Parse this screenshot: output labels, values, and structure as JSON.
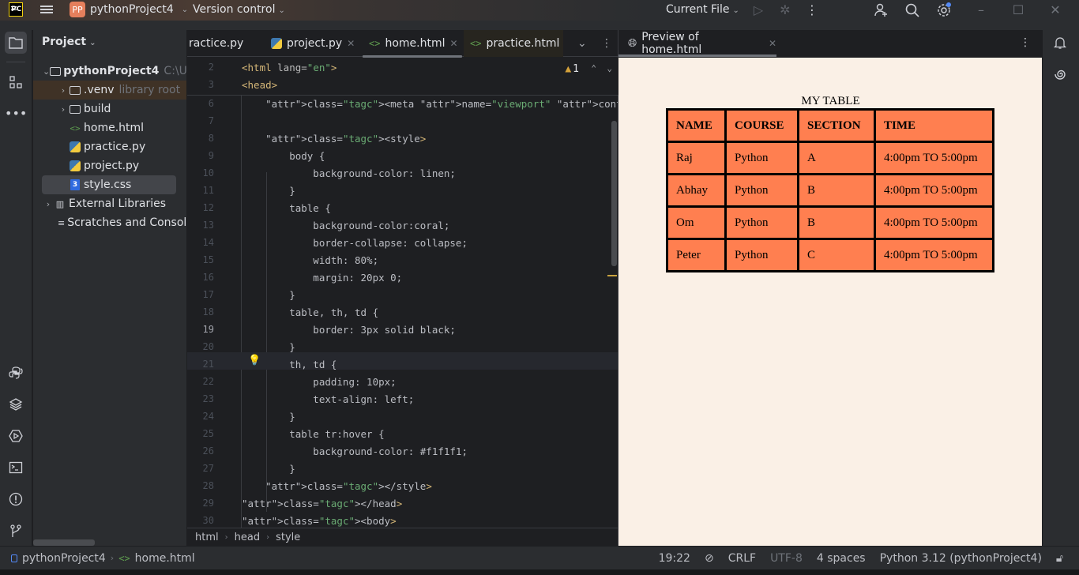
{
  "titlebar": {
    "logo": "PC",
    "project_badge": "PP",
    "project_name": "pythonProject4",
    "version_control": "Version control",
    "run_config": "Current File"
  },
  "toolwindow": {
    "title": "Project",
    "tree": [
      {
        "label": "pythonProject4",
        "suffix": "C:\\Use",
        "type": "folder",
        "expanded": true,
        "level": 0
      },
      {
        "label": ".venv",
        "suffix": "library root",
        "type": "folder",
        "expanded": false,
        "level": 1
      },
      {
        "label": "build",
        "suffix": "",
        "type": "folder",
        "expanded": false,
        "level": 1
      },
      {
        "label": "home.html",
        "suffix": "",
        "type": "html",
        "level": 1
      },
      {
        "label": "practice.py",
        "suffix": "",
        "type": "python",
        "level": 1
      },
      {
        "label": "project.py",
        "suffix": "",
        "type": "python",
        "level": 1
      },
      {
        "label": "style.css",
        "suffix": "",
        "type": "css",
        "level": 1,
        "selected": true
      },
      {
        "label": "External Libraries",
        "suffix": "",
        "type": "library",
        "level": 0
      },
      {
        "label": "Scratches and Consoles",
        "suffix": "",
        "type": "scratch",
        "level": 0
      }
    ]
  },
  "editor": {
    "tabs": [
      {
        "label": "ractice.py",
        "type": "python"
      },
      {
        "label": "project.py",
        "type": "python"
      },
      {
        "label": "home.html",
        "type": "html",
        "active": true
      },
      {
        "label": "practice.html",
        "type": "html"
      }
    ],
    "warnings_count": "1",
    "sticky_lines": [
      {
        "n": "2",
        "text": "<html lang=\"en\">"
      },
      {
        "n": "3",
        "text": "<head>"
      }
    ],
    "lines": [
      {
        "n": "6",
        "text": "    <meta name=\"viewport\" content=\"width=device-width, initi"
      },
      {
        "n": "7",
        "text": ""
      },
      {
        "n": "8",
        "text": "    <style>"
      },
      {
        "n": "9",
        "text": "        body {"
      },
      {
        "n": "10",
        "text": "            background-color: linen;"
      },
      {
        "n": "11",
        "text": "        }"
      },
      {
        "n": "12",
        "text": "        table {"
      },
      {
        "n": "13",
        "text": "            background-color:coral;"
      },
      {
        "n": "14",
        "text": "            border-collapse: collapse;"
      },
      {
        "n": "15",
        "text": "            width: 80%;"
      },
      {
        "n": "16",
        "text": "            margin: 20px 0;"
      },
      {
        "n": "17",
        "text": "        }"
      },
      {
        "n": "18",
        "text": "        table, th, td {"
      },
      {
        "n": "19",
        "text": "            border: 3px solid black;"
      },
      {
        "n": "20",
        "text": "        }"
      },
      {
        "n": "21",
        "text": "        th, td {"
      },
      {
        "n": "22",
        "text": "            padding: 10px;"
      },
      {
        "n": "23",
        "text": "            text-align: left;"
      },
      {
        "n": "24",
        "text": "        }"
      },
      {
        "n": "25",
        "text": "        table tr:hover {"
      },
      {
        "n": "26",
        "text": "            background-color: #f1f1f1;"
      },
      {
        "n": "27",
        "text": "        }"
      },
      {
        "n": "28",
        "text": "    </style>"
      },
      {
        "n": "29",
        "text": "</head>"
      },
      {
        "n": "30",
        "text": "<body>"
      }
    ],
    "current_line": "19",
    "breadcrumbs": [
      "html",
      "head",
      "style"
    ]
  },
  "preview": {
    "tab_label": "Preview of home.html",
    "caption": "MY TABLE",
    "headers": [
      "NAME",
      "COURSE",
      "SECTION",
      "TIME"
    ],
    "rows": [
      [
        "Raj",
        "Python",
        "A",
        "4:00pm TO 5:00pm"
      ],
      [
        "Abhay",
        "Python",
        "B",
        "4:00pm TO 5:00pm"
      ],
      [
        "Om",
        "Python",
        "B",
        "4:00pm TO 5:00pm"
      ],
      [
        "Peter",
        "Python",
        "C",
        "4:00pm TO 5:00pm"
      ]
    ],
    "colors": {
      "background": "#faf0e6",
      "table": "#ff7f50",
      "border": "#000000"
    }
  },
  "statusbar": {
    "project": "pythonProject4",
    "file": "home.html",
    "position": "19:22",
    "line_ending": "CRLF",
    "encoding": "UTF-8",
    "indent": "4 spaces",
    "interpreter": "Python 3.12 (pythonProject4)"
  }
}
